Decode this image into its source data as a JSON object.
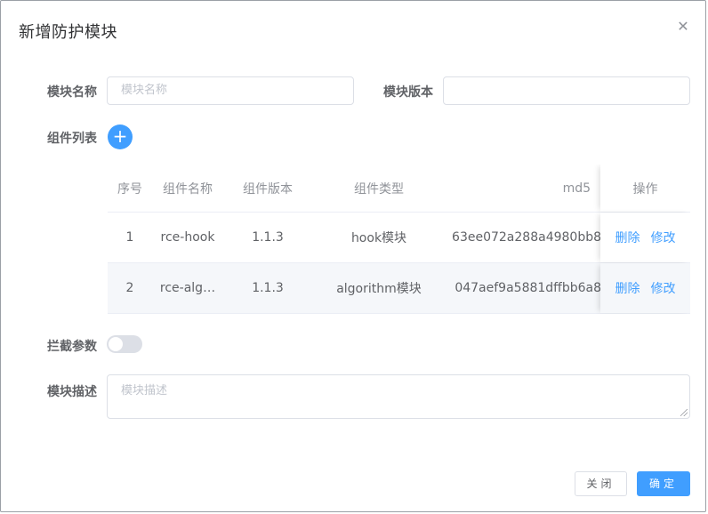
{
  "dialog": {
    "title": "新增防护模块",
    "close_icon": "close-icon"
  },
  "form": {
    "module_name_label": "模块名称",
    "module_name_placeholder": "模块名称",
    "module_name_value": "",
    "module_version_label": "模块版本",
    "module_version_value": "",
    "component_list_label": "组件列表",
    "add_icon": "plus-icon",
    "intercept_label": "拦截参数",
    "intercept_enabled": false,
    "description_label": "模块描述",
    "description_placeholder": "模块描述"
  },
  "table": {
    "headers": [
      "序号",
      "组件名称",
      "组件版本",
      "组件类型",
      "md5",
      "操作"
    ],
    "rows": [
      {
        "idx": "1",
        "name": "rce-hook",
        "version": "1.1.3",
        "type": "hook模块",
        "md5": "63ee072a288a4980bb8",
        "delete": "删除",
        "edit": "修改"
      },
      {
        "idx": "2",
        "name": "rce-alg…",
        "version": "1.1.3",
        "type": "algorithm模块",
        "md5": "047aef9a5881dffbb6a8",
        "delete": "删除",
        "edit": "修改"
      }
    ]
  },
  "footer": {
    "cancel_label": "关闭",
    "confirm_label": "确定"
  },
  "colors": {
    "primary": "#409eff",
    "border": "#dcdfe6"
  }
}
